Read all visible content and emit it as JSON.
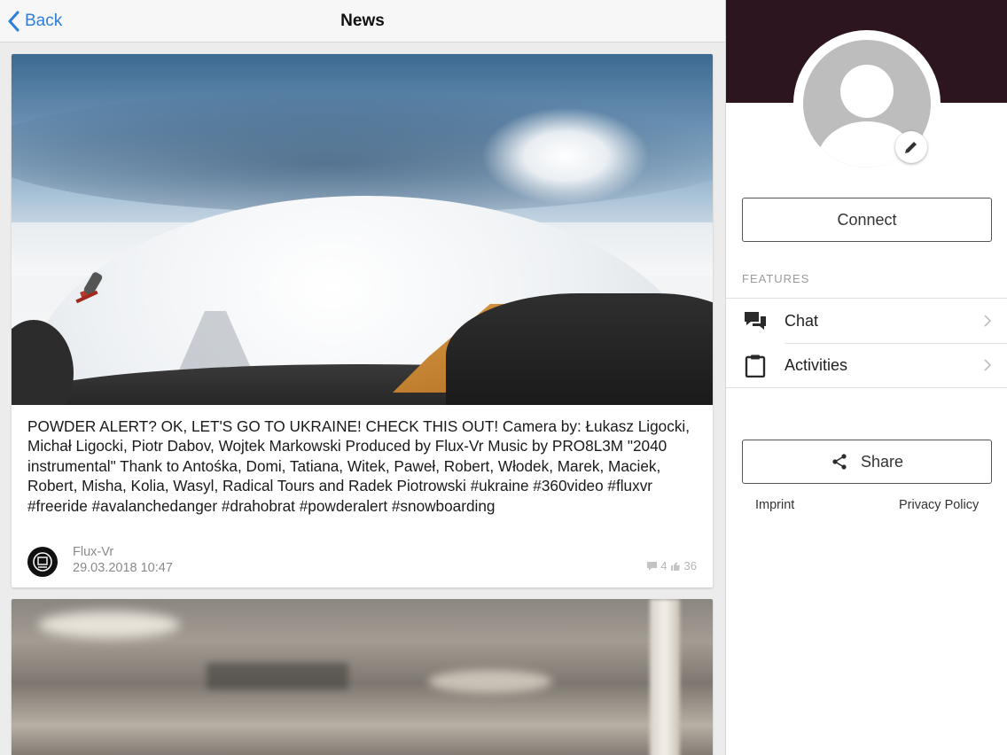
{
  "nav": {
    "back_label": "Back",
    "title": "News"
  },
  "posts": [
    {
      "text": "POWDER ALERT? OK, LET'S GO TO UKRAINE! CHECK THIS OUT! Camera by: Łukasz Ligocki, Michał Ligocki, Piotr Dabov, Wojtek Markowski Produced by Flux-Vr Music by PRO8L3M \"2040 instrumental\" Thank to Antośka, Domi, Tatiana, Witek, Paweł, Robert, Włodek, Marek, Maciek, Robert, Misha, Kolia, Wasyl, Radical Tours and Radek Piotrowski #ukraine #360video #fluxvr #freeride #avalanchedanger #drahobrat #powderalert #snowboarding",
      "author": "Flux-Vr",
      "date": "29.03.2018 10:47",
      "comments": "4",
      "likes": "36"
    }
  ],
  "profile": {
    "header_color": "#2d1520",
    "connect_label": "Connect",
    "features_heading": "FEATURES",
    "features": [
      {
        "label": "Chat",
        "icon": "chat-icon"
      },
      {
        "label": "Activities",
        "icon": "clipboard-icon"
      }
    ],
    "share_label": "Share",
    "imprint_label": "Imprint",
    "privacy_label": "Privacy Policy"
  },
  "colors": {
    "link_blue": "#2f7fd6",
    "meta_gray": "#8a8a8a"
  }
}
